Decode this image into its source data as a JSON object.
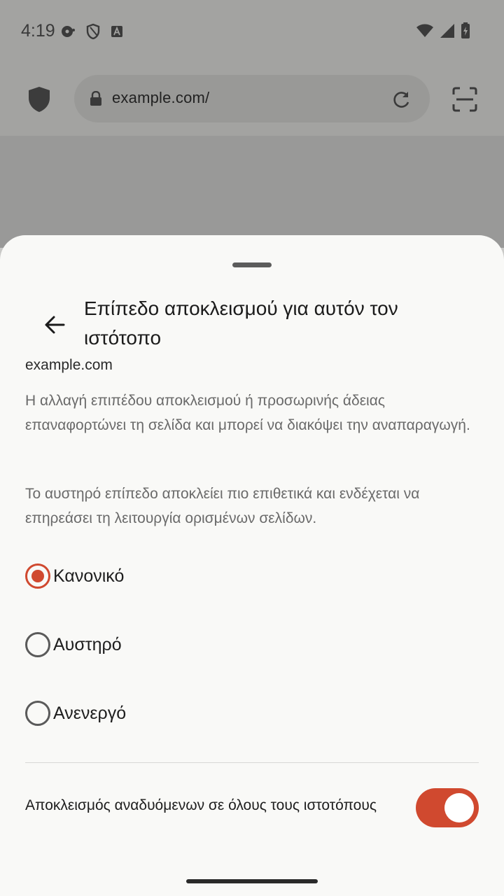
{
  "status_bar": {
    "time": "4:19",
    "left_icons": [
      "media-icon",
      "shield-outline-icon",
      "text-a-icon"
    ],
    "right_icons": [
      "wifi-icon",
      "signal-icon",
      "battery-charging-icon"
    ]
  },
  "toolbar": {
    "url": "example.com/",
    "icons": [
      "tracking-shield-icon",
      "lock-icon",
      "reload-icon",
      "scan-icon"
    ]
  },
  "sheet": {
    "title": "Επίπεδο αποκλεισμού για αυτόν τον ιστότοπο",
    "domain": "example.com",
    "description_1": "Η αλλαγή επιπέδου αποκλεισμού ή προσωρινής άδειας επαναφορτώνει τη σελίδα και μπορεί να διακόψει την αναπαραγωγή.",
    "description_2": "Το αυστηρό επίπεδο αποκλείει πιο επιθετικά και ενδέχεται να επηρεάσει τη λειτουργία ορισμένων σελίδων.",
    "options": [
      {
        "label": "Κανονικό",
        "selected": true
      },
      {
        "label": "Αυστηρό",
        "selected": false
      },
      {
        "label": "Ανενεργό",
        "selected": false
      }
    ],
    "popup_block_label": "Αποκλεισμός αναδυόμενων σε όλους τους ιστοτόπους",
    "popup_block_enabled": true
  },
  "colors": {
    "accent": "#d0492f",
    "scrim": "#a3a3a1",
    "sheet_background": "#f9f9f7"
  }
}
